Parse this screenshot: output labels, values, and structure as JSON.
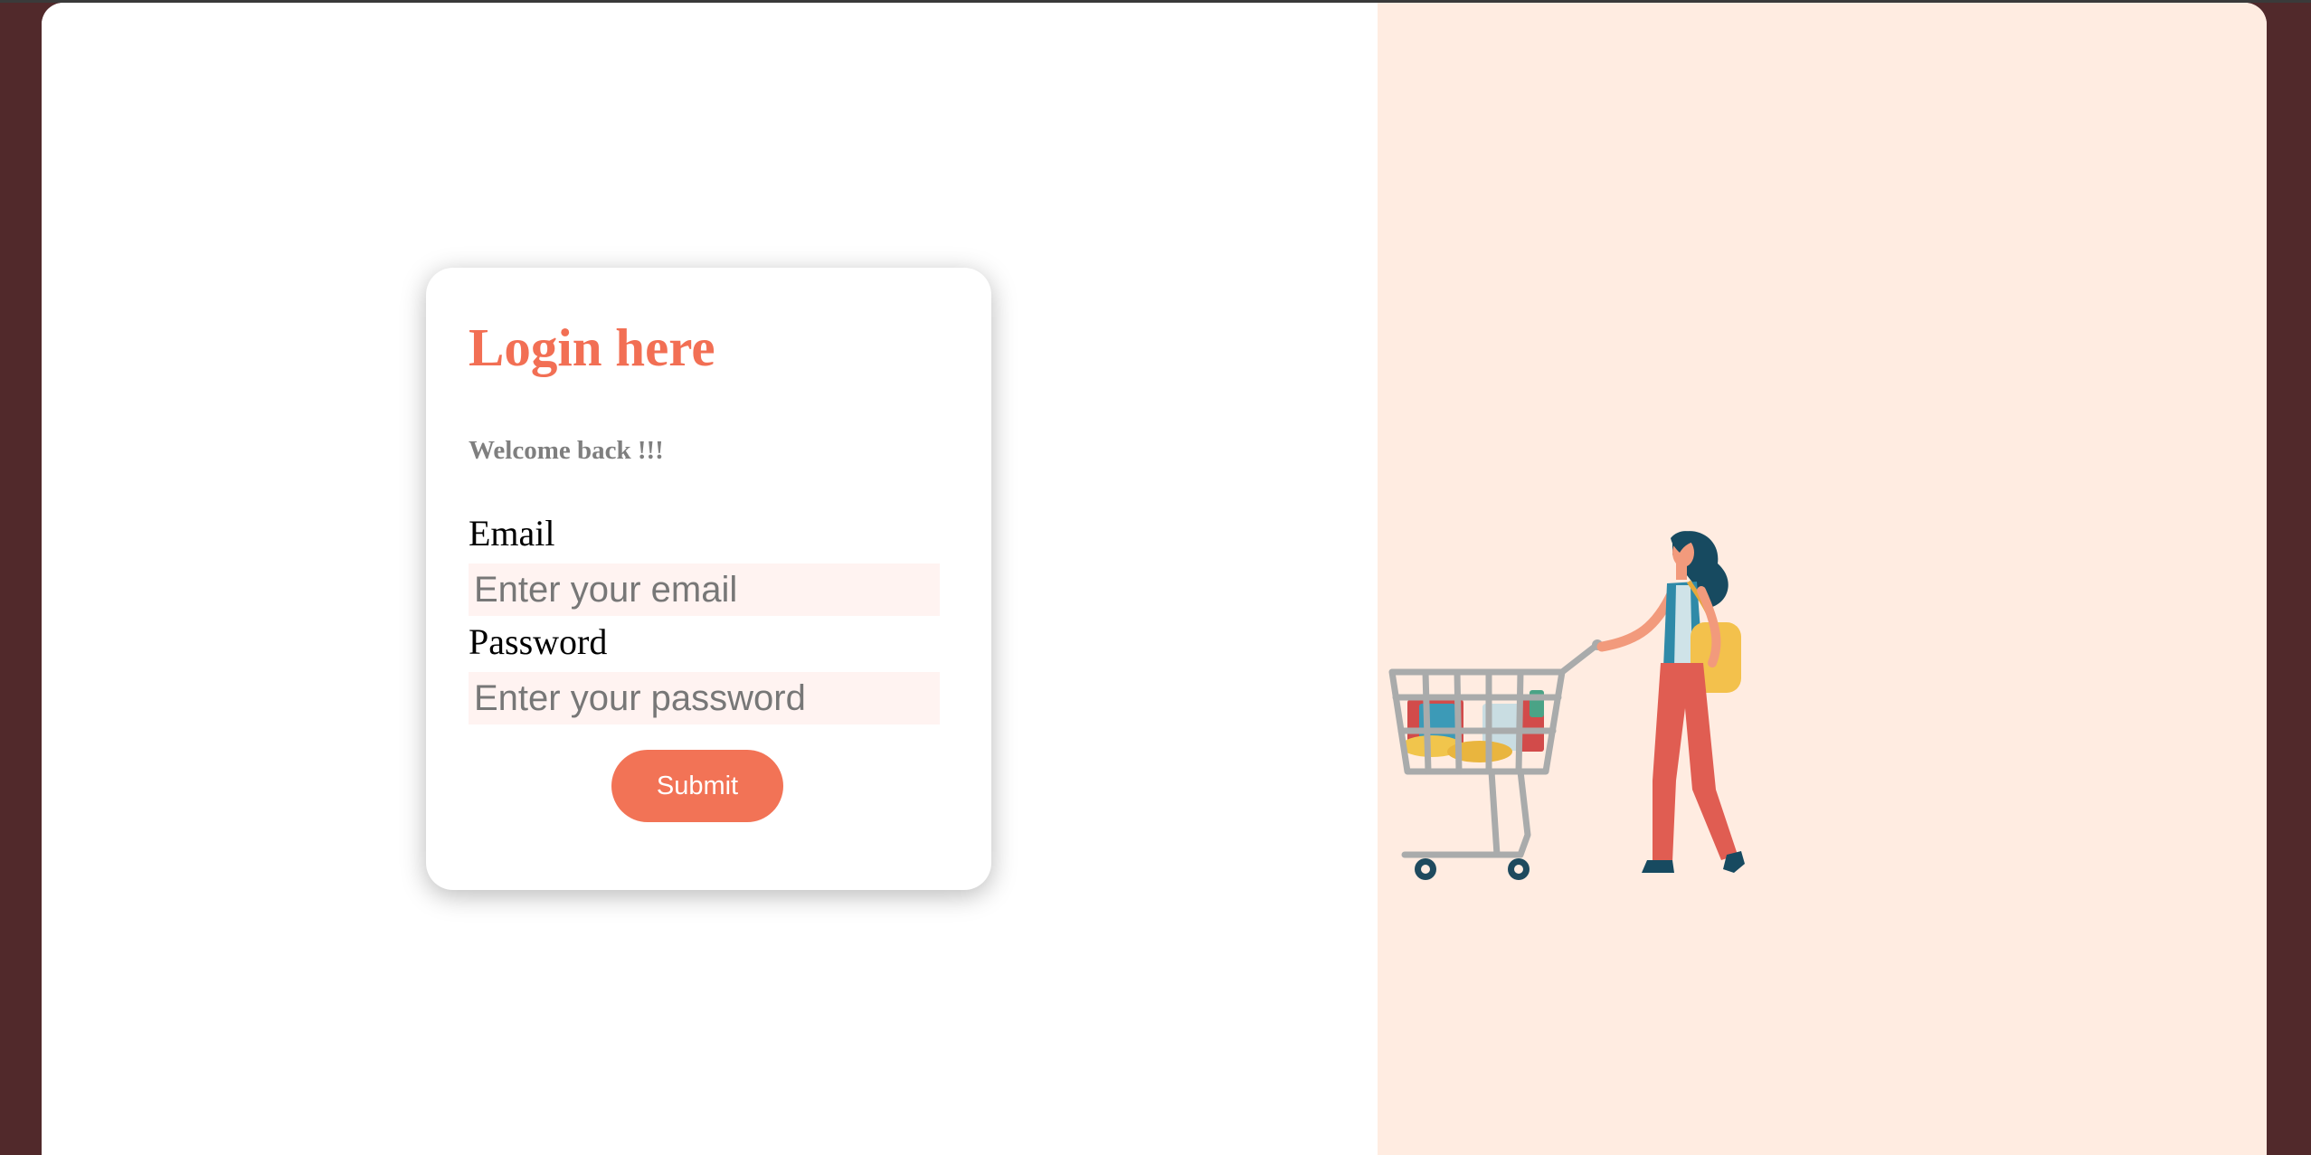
{
  "login": {
    "title": "Login here",
    "subtitle": "Welcome back !!!",
    "email_label": "Email",
    "email_placeholder": "Enter your email",
    "email_value": "",
    "password_label": "Password",
    "password_placeholder": "Enter your password",
    "password_value": "",
    "submit_label": "Submit"
  },
  "colors": {
    "accent": "#f26f54",
    "page_background": "#51292b",
    "right_panel": "#ffece1",
    "input_background": "#fff3f1",
    "subtitle": "#7f7f7f"
  },
  "illustration": {
    "subject": "woman-pushing-shopping-cart-illustration"
  }
}
